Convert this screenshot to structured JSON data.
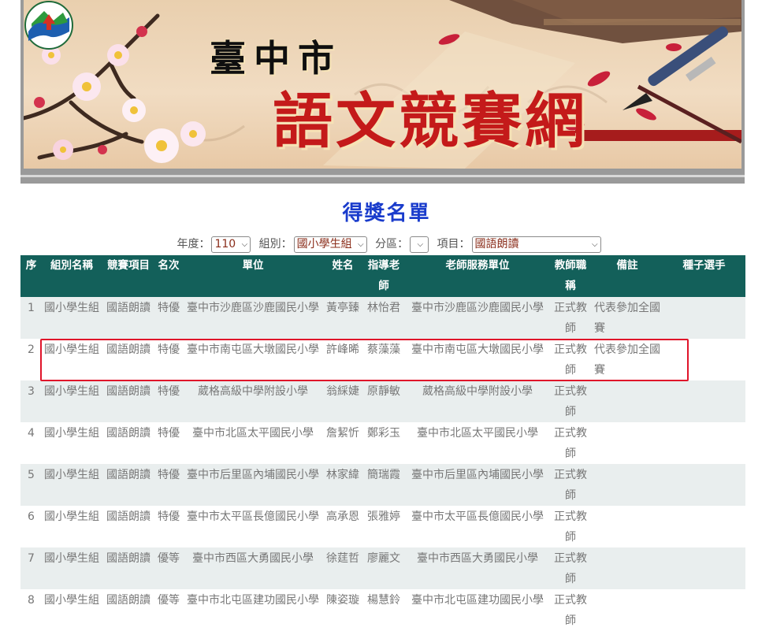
{
  "banner": {
    "city": "臺中市",
    "site_name": "語文競賽網"
  },
  "page_title": "得獎名單",
  "filters": {
    "year_label": "年度：",
    "year_value": "110",
    "group_label": "組別：",
    "group_value": "國小學生組",
    "district_label": "分區：",
    "district_value": "",
    "item_label": "項目：",
    "item_value": "國語朗讀"
  },
  "table": {
    "headers": [
      "序",
      "組別名稱",
      "競賽項目",
      "名次",
      "單位",
      "姓名",
      "指導老師",
      "老師服務單位",
      "教師職稱",
      "備註",
      "種子選手"
    ],
    "rows": [
      [
        "1",
        "國小學生組",
        "國語朗讀",
        "特優",
        "臺中市沙鹿區沙鹿國民小學",
        "黃亭臻",
        "林怡君",
        "臺中市沙鹿區沙鹿國民小學",
        "正式教師",
        "代表參加全國賽",
        ""
      ],
      [
        "2",
        "國小學生組",
        "國語朗讀",
        "特優",
        "臺中市南屯區大墩國民小學",
        "許峰晞",
        "蔡藻藻",
        "臺中市南屯區大墩國民小學",
        "正式教師",
        "代表參加全國賽",
        ""
      ],
      [
        "3",
        "國小學生組",
        "國語朗讀",
        "特優",
        "葳格高級中學附設小學",
        "翁綵婕",
        "原靜敏",
        "葳格高級中學附設小學",
        "正式教師",
        "",
        ""
      ],
      [
        "4",
        "國小學生組",
        "國語朗讀",
        "特優",
        "臺中市北區太平國民小學",
        "詹絜忻",
        "鄭彩玉",
        "臺中市北區太平國民小學",
        "正式教師",
        "",
        ""
      ],
      [
        "5",
        "國小學生組",
        "國語朗讀",
        "特優",
        "臺中市后里區內埔國民小學",
        "林家緯",
        "簡瑞霞",
        "臺中市后里區內埔國民小學",
        "正式教師",
        "",
        ""
      ],
      [
        "6",
        "國小學生組",
        "國語朗讀",
        "特優",
        "臺中市太平區長億國民小學",
        "高承恩",
        "張雅婷",
        "臺中市太平區長億國民小學",
        "正式教師",
        "",
        ""
      ],
      [
        "7",
        "國小學生組",
        "國語朗讀",
        "優等",
        "臺中市西區大勇國民小學",
        "徐莛哲",
        "廖麗文",
        "臺中市西區大勇國民小學",
        "正式教師",
        "",
        ""
      ],
      [
        "8",
        "國小學生組",
        "國語朗讀",
        "優等",
        "臺中市北屯區建功國民小學",
        "陳姿璇",
        "楊慧鈴",
        "臺中市北屯區建功國民小學",
        "正式教師",
        "",
        ""
      ]
    ]
  },
  "icons": {
    "select_arrow": "chevron-down-icon",
    "logo": "city-logo-icon"
  },
  "colors": {
    "header_bg": "#13605a",
    "title": "#1a3ccc",
    "highlight": "#e0142a",
    "row_alt": "#e9eeee"
  }
}
